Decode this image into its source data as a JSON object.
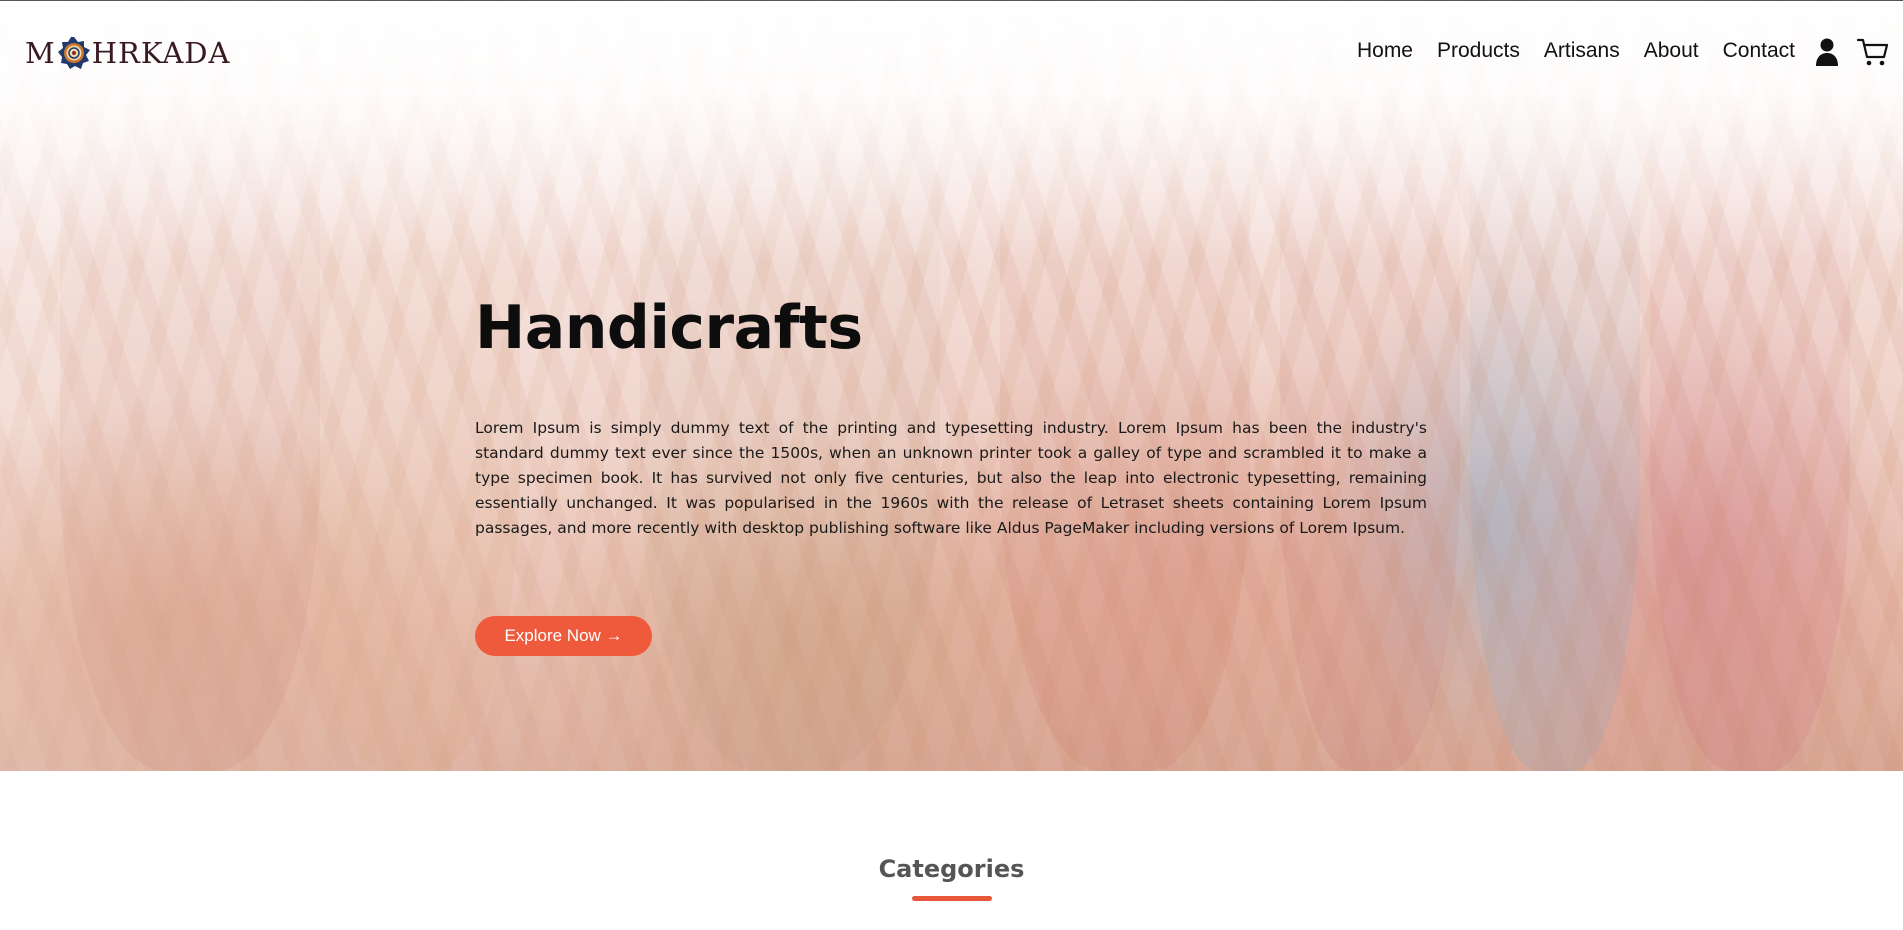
{
  "brand": {
    "logo_prefix": "M",
    "logo_suffix": "HRKADA",
    "logo_mark_icon": "mandala-icon",
    "logo_color": "#3a1a22"
  },
  "nav": {
    "links": [
      {
        "label": "Home"
      },
      {
        "label": "Products"
      },
      {
        "label": "Artisans"
      },
      {
        "label": "About"
      },
      {
        "label": "Contact"
      }
    ],
    "user_icon": "user-icon",
    "cart_icon": "cart-icon"
  },
  "hero": {
    "title": "Handicrafts",
    "body": "Lorem Ipsum is simply dummy text of the printing and typesetting industry. Lorem Ipsum has been the industry's standard dummy text ever since the 1500s, when an unknown printer took a galley of type and scrambled it to make a type specimen book. It has survived not only five centuries, but also the leap into electronic typesetting, remaining essentially unchanged. It was popularised in the 1960s with the release of Letraset sheets containing Lorem Ipsum passages, and more recently with desktop publishing software like Aldus PageMaker including versions of Lorem Ipsum.",
    "cta_label": "Explore Now →",
    "cta_color": "#f05a3c"
  },
  "categories": {
    "title": "Categories",
    "accent_color": "#e8573a"
  }
}
